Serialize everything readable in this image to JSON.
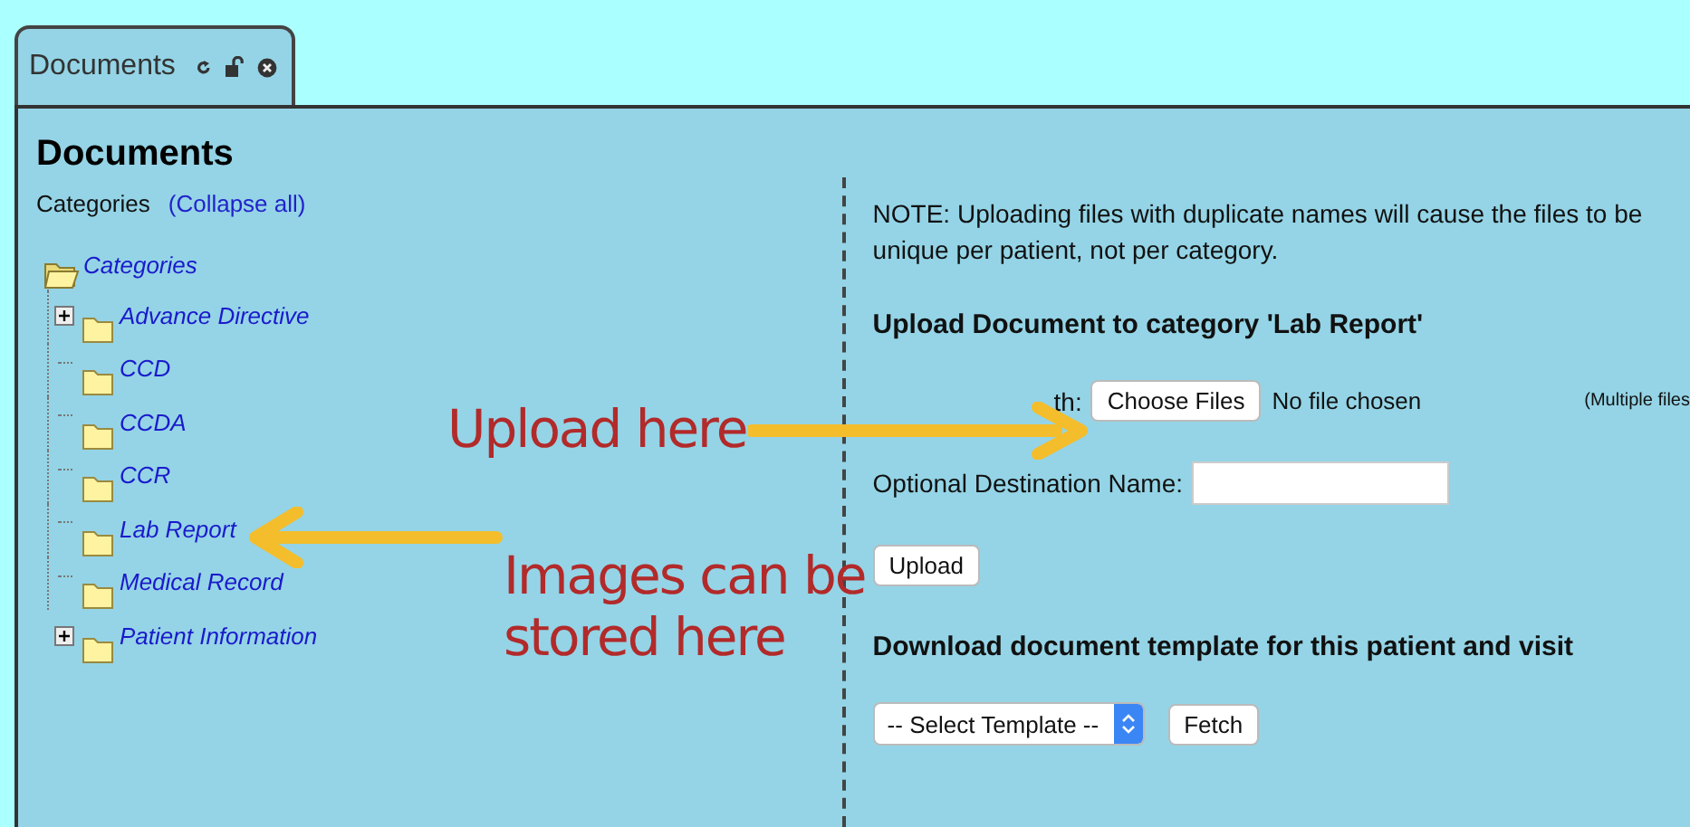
{
  "tab": {
    "label": "Documents",
    "selected": true
  },
  "panel": {
    "title": "Documents",
    "categories_label": "Categories",
    "collapse_link": "(Collapse all)"
  },
  "tree": {
    "label": "Categories",
    "expanded": true,
    "children": [
      {
        "label": "Advance Directive",
        "expandable": true
      },
      {
        "label": "CCD",
        "expandable": false
      },
      {
        "label": "CCDA",
        "expandable": false
      },
      {
        "label": "CCR",
        "expandable": false
      },
      {
        "label": "Lab Report",
        "expandable": false
      },
      {
        "label": "Medical Record",
        "expandable": false
      },
      {
        "label": "Patient Information",
        "expandable": true
      }
    ]
  },
  "note_lines": [
    "NOTE: Uploading files with duplicate names will cause the files to be",
    "unique per patient, not per category."
  ],
  "upload_heading": "Upload Document to category 'Lab Report'",
  "source_label": "th:",
  "choose_button": "Choose Files",
  "file_status": "No file chosen",
  "multiple_hint": "(Multiple files",
  "destination_label": "Optional Destination Name:",
  "upload_button": "Upload",
  "download_heading": "Download document template for this patient and visit",
  "template_select": "-- Select Template --",
  "fetch_button": "Fetch",
  "annotations": [
    {
      "text": "Upload here",
      "kind": "right"
    },
    {
      "text": "Images can be stored here",
      "kind": "left"
    }
  ]
}
